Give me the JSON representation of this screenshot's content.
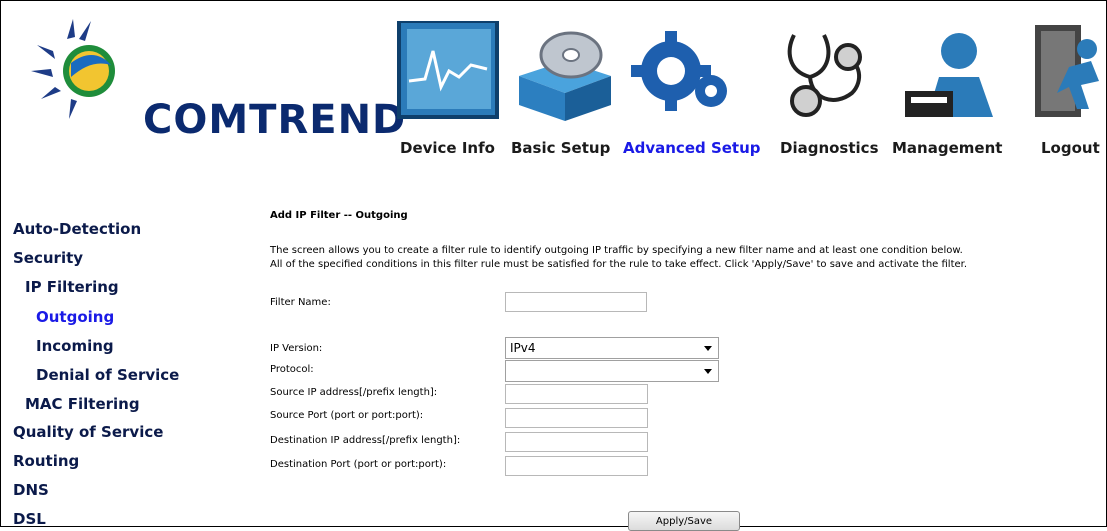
{
  "brand": {
    "name": "COMTREND"
  },
  "nav": [
    {
      "label": "Device Info",
      "icon": "device-info-chart-icon"
    },
    {
      "label": "Basic Setup",
      "icon": "basic-setup-disc-box-icon"
    },
    {
      "label": "Advanced Setup",
      "icon": "advanced-setup-gears-icon",
      "active": true
    },
    {
      "label": "Diagnostics",
      "icon": "diagnostics-stethoscope-icon"
    },
    {
      "label": "Management",
      "icon": "management-person-icon"
    },
    {
      "label": "Logout",
      "icon": "logout-door-runner-icon"
    }
  ],
  "sidebar": {
    "items": [
      {
        "label": "Auto-Detection"
      },
      {
        "label": "Security"
      },
      {
        "label": "IP Filtering"
      },
      {
        "label": "Outgoing",
        "active": true
      },
      {
        "label": "Incoming"
      },
      {
        "label": "Denial of Service"
      },
      {
        "label": "MAC Filtering"
      },
      {
        "label": "Quality of Service"
      },
      {
        "label": "Routing"
      },
      {
        "label": "DNS"
      },
      {
        "label": "DSL"
      }
    ]
  },
  "main": {
    "title": "Add IP Filter -- Outgoing",
    "description_line1": "The screen allows you to create a filter rule to identify outgoing IP traffic by specifying a new filter name and at least one condition below.",
    "description_line2": "All of the specified conditions in this filter rule must be satisfied for the rule to take effect. Click 'Apply/Save' to save and activate the filter.",
    "filter_name_label": "Filter Name:",
    "filter_name_value": "",
    "ip_version_label": "IP Version:",
    "ip_version_value": "IPv4",
    "protocol_label": "Protocol:",
    "protocol_value": "",
    "src_ip_label": "Source IP address[/prefix length]:",
    "src_port_label": "Source Port (port or port:port):",
    "dst_ip_label": "Destination IP address[/prefix length]:",
    "dst_port_label": "Destination Port (port or port:port):",
    "apply_label": "Apply/Save"
  },
  "colors": {
    "active_link": "#1a1ae6",
    "logo_blue": "#0b2a6f"
  }
}
